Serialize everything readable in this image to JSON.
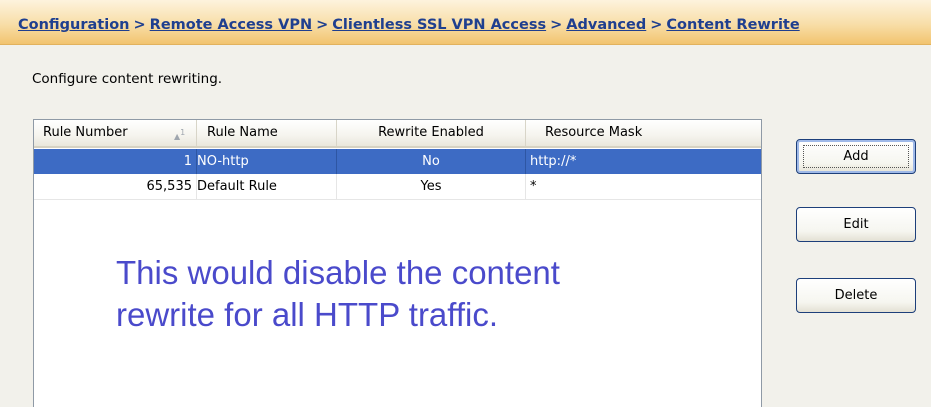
{
  "breadcrumb": {
    "items": [
      "Configuration",
      "Remote Access VPN",
      "Clientless SSL VPN Access",
      "Advanced",
      "Content Rewrite"
    ],
    "separator": ">"
  },
  "description": "Configure content rewriting.",
  "table": {
    "columns": {
      "rule_number": "Rule Number",
      "rule_name": "Rule Name",
      "rewrite_enabled": "Rewrite Enabled",
      "resource_mask": "Resource Mask"
    },
    "sort": {
      "arrow": "▲",
      "index": "1"
    },
    "rows": [
      {
        "rule_number": "1",
        "rule_name": "NO-http",
        "rewrite_enabled": "No",
        "resource_mask": "http://*"
      },
      {
        "rule_number": "65,535",
        "rule_name": "Default Rule",
        "rewrite_enabled": "Yes",
        "resource_mask": "*"
      }
    ]
  },
  "annotation": {
    "line1": "This would disable the content",
    "line2": "rewrite for all HTTP traffic."
  },
  "buttons": {
    "add": "Add",
    "edit": "Edit",
    "delete": "Delete"
  },
  "colors": {
    "selection": "#3d6bc4",
    "annotation_text": "#4a4acb",
    "breadcrumb_link": "#1f3f8f"
  }
}
